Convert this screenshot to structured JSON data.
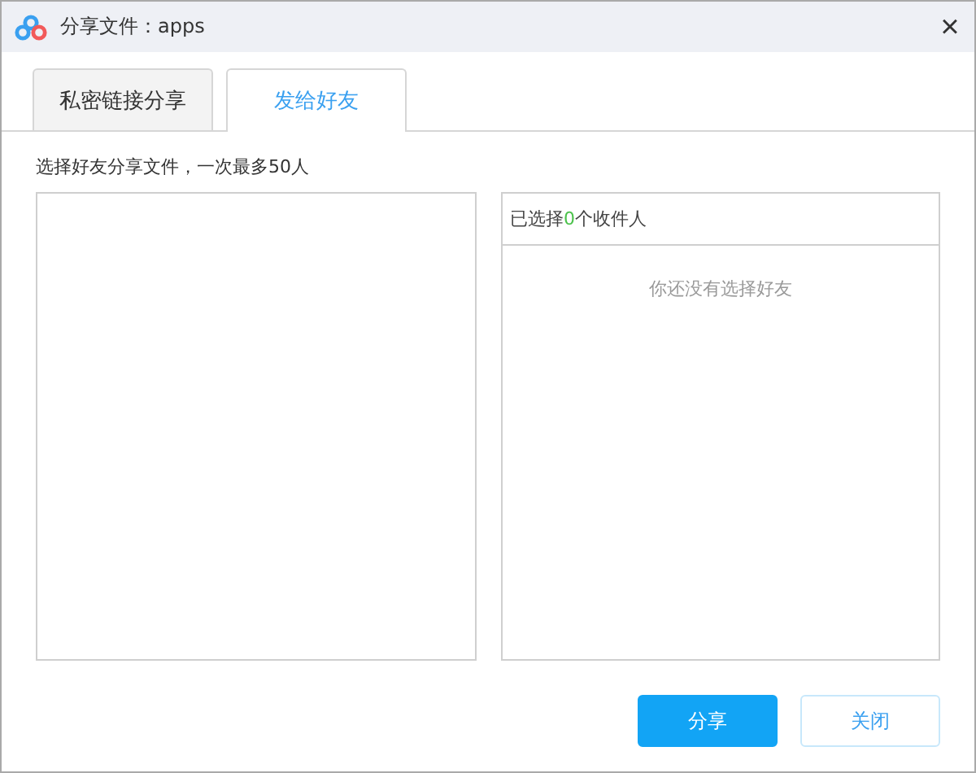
{
  "window": {
    "title": "分享文件：apps",
    "close": "×"
  },
  "tabs": [
    {
      "label": "私密链接分享",
      "selected": false
    },
    {
      "label": "发给好友",
      "selected": true
    }
  ],
  "hint": "选择好友分享文件，一次最多50人",
  "selected_panel": {
    "prefix": "已选择",
    "count": "0",
    "suffix": "个收件人",
    "empty_text": "你还没有选择好友"
  },
  "buttons": [
    {
      "label": "分享",
      "kind": "primary"
    },
    {
      "label": "关闭",
      "kind": "secondary"
    }
  ]
}
